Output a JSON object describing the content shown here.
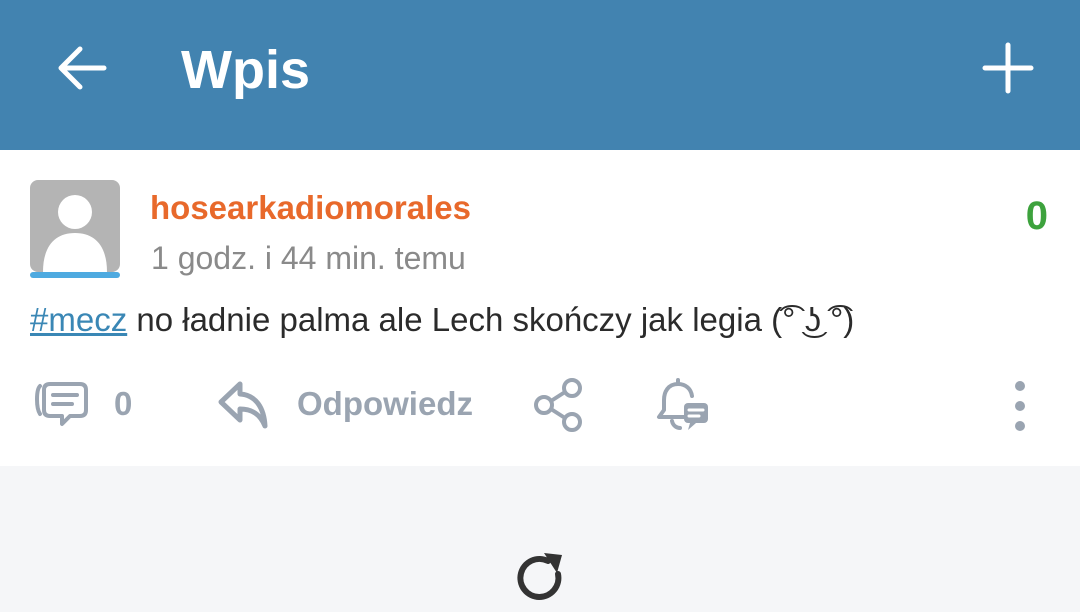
{
  "header": {
    "title": "Wpis",
    "back_icon": "arrow-left-icon",
    "add_icon": "plus-icon",
    "background": "#4283b0"
  },
  "post": {
    "author": "hosearkadiomorales",
    "author_color": "#e8692b",
    "time_ago": "1 godz. i 44 min. temu",
    "votes": "0",
    "votes_color": "#3da23d",
    "hashtag": "#mecz",
    "body": " no ładnie palma ale Lech skończy jak legia (͡° ͜ʖ ͡°)",
    "comments_count": "0",
    "reply_label": "Odpowiedz",
    "icons": {
      "comments": "comments-icon",
      "reply": "reply-icon",
      "share": "share-icon",
      "notify": "bell-comment-icon",
      "more": "more-vertical-icon"
    }
  },
  "footer": {
    "refresh_icon": "refresh-icon"
  }
}
